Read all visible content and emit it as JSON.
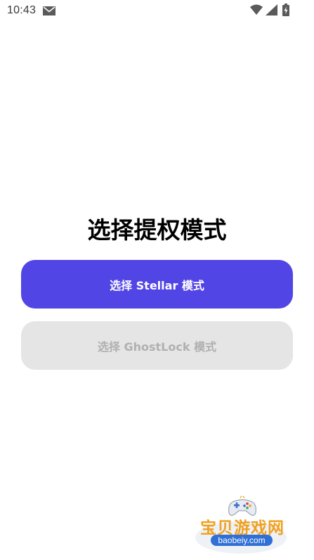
{
  "status_bar": {
    "time": "10:43",
    "icons": [
      "mail-icon",
      "wifi-icon",
      "signal-icon",
      "battery-icon"
    ]
  },
  "main": {
    "title": "选择提权模式",
    "buttons": [
      {
        "label": "选择 Stellar 模式",
        "state": "enabled",
        "color": "#5245e5"
      },
      {
        "label": "选择 GhostLock 模式",
        "state": "disabled",
        "color": "#e5e5e5"
      }
    ]
  },
  "watermark": {
    "title": "宝贝游戏网",
    "url": "baobeiy.com"
  }
}
